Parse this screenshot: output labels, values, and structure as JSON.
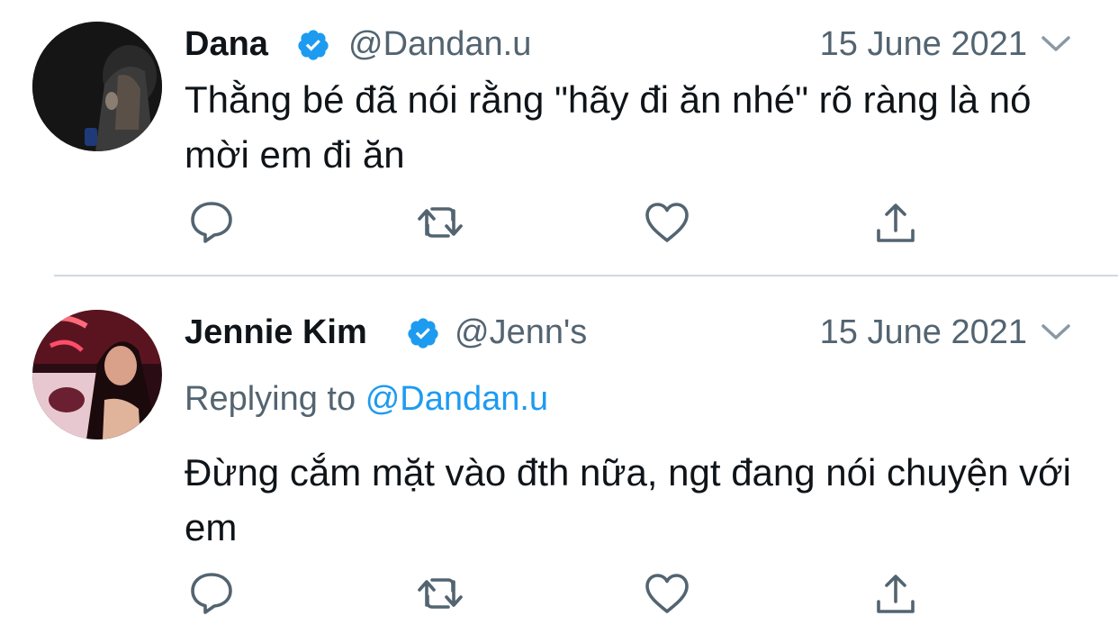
{
  "colors": {
    "text": "#0f1419",
    "secondary": "#536471",
    "link": "#1d9bf0",
    "verified": "#1d9bf0",
    "divider": "#cfd9de",
    "action_icon": "#536471"
  },
  "tweets": [
    {
      "avatar_icon": "profile-photo",
      "name": "Dana",
      "verified_icon": "verified-badge-icon",
      "handle": "@Dandan.u",
      "date": "15 June 2021",
      "menu_icon": "chevron-down-icon",
      "text": "Thằng bé đã nói rằng \"hãy đi ăn nhé\" rõ ràng là nó mời em đi ăn",
      "actions": [
        "reply-icon",
        "retweet-icon",
        "like-icon",
        "share-icon"
      ]
    },
    {
      "avatar_icon": "profile-photo",
      "name": "Jennie Kim",
      "verified_icon": "verified-badge-icon",
      "handle": "@Jenn's",
      "date": "15 June 2021",
      "menu_icon": "chevron-down-icon",
      "replying_label": "Replying to",
      "replying_handle": "@Dandan.u",
      "text": "Đừng cắm mặt vào đth nữa, ngt đang nói chuyện với em",
      "actions": [
        "reply-icon",
        "retweet-icon",
        "like-icon",
        "share-icon"
      ]
    }
  ]
}
